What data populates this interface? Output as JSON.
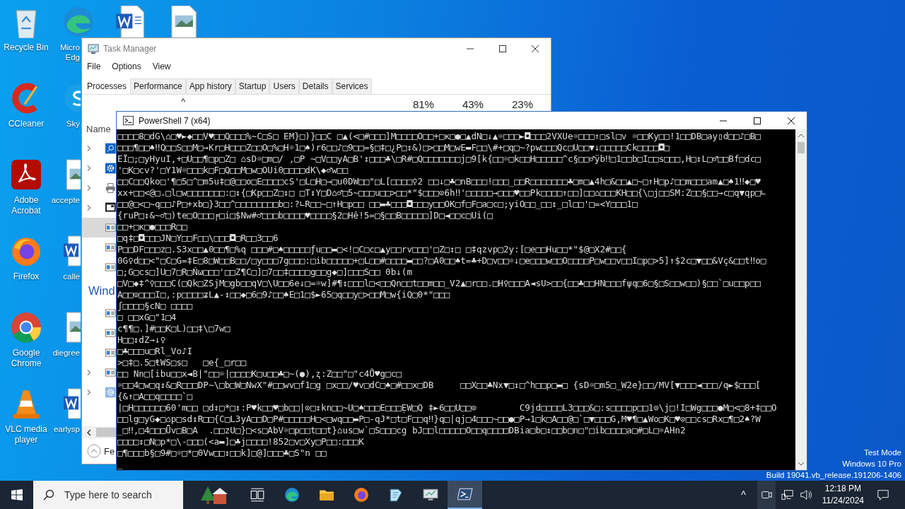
{
  "desktop": {
    "icon_rows": [
      [
        {
          "kind": "recycle",
          "label": "Recycle Bin"
        },
        {
          "kind": "edge",
          "label": "Micro\nEdg"
        },
        {
          "kind": "word"
        },
        {
          "kind": "image"
        }
      ],
      [
        {
          "kind": "ccleaner",
          "label": "CCleaner"
        },
        {
          "kind": "skype",
          "label": "Sky"
        }
      ],
      [
        {
          "kind": "acrobat",
          "label": "Adobe\nAcrobat"
        },
        {
          "kind": "image",
          "label": "accepte"
        }
      ],
      [
        {
          "kind": "firefox",
          "label": "Firefox"
        },
        {
          "kind": "word",
          "label": "calle"
        }
      ],
      [
        {
          "kind": "chrome",
          "label": "Google\nChrome"
        },
        {
          "kind": "image",
          "label": "diegree"
        }
      ],
      [
        {
          "kind": "vlc",
          "label": "VLC media\nplayer"
        },
        {
          "kind": "word",
          "label": "earlysp"
        }
      ]
    ],
    "test_mode": [
      "Test Mode",
      "Windows 10 Pro",
      "Build 19041.vb_release.191206-1406"
    ]
  },
  "task_manager": {
    "title": "Task Manager",
    "menu": [
      "File",
      "Options",
      "View"
    ],
    "tabs": [
      {
        "label": "Processes",
        "selected": true
      },
      {
        "label": "Performance",
        "selected": false
      },
      {
        "label": "App history",
        "selected": false
      },
      {
        "label": "Startup",
        "selected": false
      },
      {
        "label": "Users",
        "selected": false
      },
      {
        "label": "Details",
        "selected": false
      },
      {
        "label": "Services",
        "selected": false
      }
    ],
    "sort_arrow": "^",
    "column_stats": [
      "81%",
      "43%",
      "23%"
    ],
    "name_header": "Name",
    "fewer_details": "Fe",
    "rows": [
      {
        "kind": "search",
        "expandable": true,
        "selected": false
      },
      {
        "kind": "gear",
        "expandable": true,
        "selected": false
      },
      {
        "kind": "printer",
        "expandable": true,
        "selected": false
      },
      {
        "kind": "window",
        "expandable": true,
        "selected": false
      },
      {
        "kind": "app",
        "expandable": false,
        "selected": true
      },
      {
        "kind": "app",
        "expandable": false,
        "selected": false
      },
      {
        "kind": "app",
        "expandable": false,
        "selected": false
      }
    ],
    "group": {
      "heading": "Wind",
      "rows": [
        {
          "kind": "app",
          "expandable": false,
          "selected": false
        },
        {
          "kind": "app",
          "expandable": false,
          "selected": false
        },
        {
          "kind": "app",
          "expandable": false,
          "selected": false
        },
        {
          "kind": "app",
          "expandable": true,
          "selected": false
        },
        {
          "kind": "gear",
          "expandable": true,
          "selected": false
        }
      ]
    }
  },
  "powershell": {
    "title": "PowerShell 7 (x64)",
    "lines": [
      "□□□□8□dG\\⌂□♥►◆□□V♥□□Q□□□%~C□S□ EM}□)}□□C □▲(<□#□□□]M□□□□O□□+□κ□●□▲dN□↓▲☼□□□►◘□□□2VXUe☼□□□↑□sl□v ☼□□Ky□□!1□□DB□ay▯d□□♪□B□",
      "□□□¶□□♠‼Q□□S□□M□→Kr□H□□□Z□□O□%□H☼1□♠)r6□□♪□9□□=§□‡□¿P□↕&)□>□□M□wE▬F□□\\#+□q□~?pw□□□Qc□U□□▼↓□□□□□Ck□□□□◘□",
      "EÏ□;□yHyuI,+□U□□¶□p□Z□ ⌂sD☼□m□/ ,□P ~□V□□yA□B'↕□□□♣\\□R#□Q□□□□□□□j□9[k{□□☼□k□□H□□□□□^c§□□♂ÿb‼□1□□b□I□□s□□□,H□↕L□♂□□Bf□dc□",
      "'□K□cv?'□Y1W☼□□□k□F□Q□□M□w□OUi0□□□□dK\\◆♂w□□",
      "□□C□□Qko□'¶□5□^□m5u‡□@□□o□E□□□□cS'□L□H□→□u0DW□□\"□L[□□□□♀2 □□↓□♣□nB□□□!□□□_□□R□□□□□□□♣□m□▲4h□&□□▲□~□↑H□p♪□□m□□□am▲□♠1‼◆□♥",
      "xx+□□<@□.□l□w□□□□□□□:□↕{□Kp□□Z□↕□ □T↕Y□D⌂♂□5~□□□u□□>□□*\"$□□□⊙6h‼'□□□□□→□□□♥□□Pk□□□□↑□□]□□⌂□□□KH□□{\\□j□□SM:Z□□§□□→c□q▼qp□∟",
      "□□@□<□~q□□♪P□+xb□}3□□^□□□□□□□□b□:?∟R□□~□↑H□p□□ □□▬♣□□□◘□□□y□□OK□f□F□a□c□;yiO□□_□□↕_□l□□'□=<Y□□□1□",
      "{ruP□↕&~♂□)te□O□□□╒□i□$Nw#♂□□□b□□□□♥□□□□§2□Hê!5=□§□□B□□□□□]D□◄□□c□Ui(□",
      "□□+□κ□●□□□R□□",
      "□q‡□◘□□□JN□Y□□F□□\\□□□◘□R□□3□□6",
      "P□□DF□□□z□.S3x□□▲0□□¶□%q □□□#□♠□□□□□ƒu□□▬□<!□C□c□▲y□□rv□□□'□Z□↕□ □‡qzvp□2y:[□e□□Hu□□*\"$@□X2#□□{",
      "0G♀d□□<\"□C□G=‡E□8□W□□B□□/□y□□□7g□□□:□ib□□□□□+□L□□#□□□□▬□□?□A0□□♠t=♣+D□v□□☼↓□e□□□w□□O□□□□P□w□□v□□I□p□>5]↑$2c□▼□□&Vç&□□t‼o□",
      "□;G□cs□]U□7□R□Ńω□□□'□□Z¶C□]□7□□‡□□□□g□□g◆□]□□□S□□ 0b↓(m",
      "□V□◆‡^♀□□□C(□Qk□ZSjM□gb□□qV□\\U□□6e↓□=☼w]#¶↕□□□l□<□□Qn□□t□□m□□_V2▲□r□□.□H♀□□□A◄sU>□□{□□♣□□HN□□□fψq□6□§□S□□w□□)§□□`□u□□p□□",
      "A□□⊙□□□I□,:p□□□□ʑL▲-↕□□◆□6□9♪□□♠E□1□$►65□q□□y□>□□M□w{iQ□0*\"□□□",
      "ʃ□□□□§cN□ □□□□",
      "□ □□xG□\"1□4",
      "c¶¶□.]#□□K□L)□□‡\\□7w□",
      "H□□↕dZ→↓♀",
      "□♣□□□u□Rl_Vo♪I",
      ">□‡□.5□ŧWS□s□   □e{_□r□□",
      "□□ Nn□[ibu□□x◄B|\"□□☼|□□□□K□u□□♣□~(●),ʐ:Z□□\"□\"c4Ů♥g□c□",
      "☼□□4□w□q↕&□R□□□DP~\\□b□W□NwX\"#□□wv□f1□g □x□□/♥v□dC□♠□#□□x□DB     □□X□□♣Nx▼□↕□^h□□p□▬□ {sD☼□m5□_W2e}□□/MV[▼□□□◄□□□/q►$□□□[",
      "{&↑□A□□q□□□□`□",
      "|□H□□□□□□60'm□□ □d↕□*□↕:P♥k□□♥□b□□|⊙□↕kn□□~U□♠□□□E□□□ẸW□Q ‡►6□□U□□⊙        C9jd□□□□L3□□□&□:s□□□□p□□1⊙\\j□!I□Wg□□□●M□<□8+‡□□O",
      "□□lg□yG◆□⌂p□sd↕R□□{C□L3yA□□D□P#□□□□□H□<□wq□□▬P□-qJ*□t□F□□q‼}q□|qj□4□□□~□□●□P→1□k□A□□@□`□▼□□□G,M♥¶□▲Wo□K□♥⊙□□cs□Rx□¶□2♠?W",
      "_□‼,□4□□□Ǖv□B□A  .□□zU□}□<s□AbV☼□p□□t□□t}⌂us□w`□S□□□cg bJ□□l□□□□□O□□q□□□□DBia□b□↕□□b□n□\"□ib□□□□a□#□L□☼AHn2",
      "□□□□↕□N□p*□\\-□□□(<a▬]□♣j□□□□!852□v□Xy□P□□:□□□K",
      "□¶□□□b§□9#□☼□*□0Vw□□↕□□k]□@]□□□♣□S\"n □□",
      "_"
    ]
  },
  "taskbar": {
    "search_placeholder": "Type here to search",
    "apps": [
      {
        "kind": "tree",
        "active": false
      },
      {
        "kind": "taskview",
        "active": false
      },
      {
        "kind": "edge",
        "active": false
      },
      {
        "kind": "folder",
        "active": false
      },
      {
        "kind": "firefox",
        "active": false
      },
      {
        "kind": "notes",
        "active": false
      },
      {
        "kind": "monitor",
        "active": false
      },
      {
        "kind": "powershell",
        "active": true
      }
    ],
    "tray_arrow": "^",
    "time": "12:18 PM",
    "date": "11/24/2024"
  }
}
